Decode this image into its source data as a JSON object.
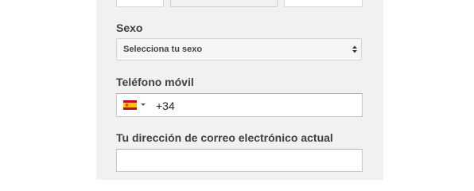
{
  "gender": {
    "label": "Sexo",
    "selected": "Selecciona tu sexo"
  },
  "phone": {
    "label": "Teléfono móvil",
    "country_flag": "spain-flag-icon",
    "value": "+34"
  },
  "email": {
    "label": "Tu dirección de correo electrónico actual",
    "value": ""
  },
  "colors": {
    "panel_bg": "#f1f1f1",
    "label_text": "#404040",
    "flag_red": "#c60b1e",
    "flag_yellow": "#ffc400"
  }
}
